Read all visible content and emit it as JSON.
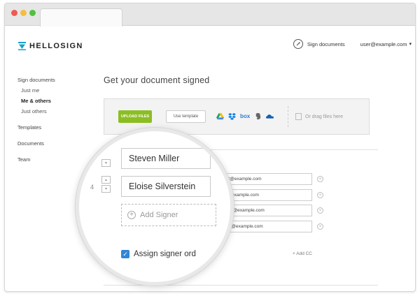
{
  "brand": {
    "name": "HELLOSIGN",
    "color": "#18a0c9"
  },
  "header": {
    "sign_link": "Sign documents",
    "user_email": "user@example.com",
    "icons": {
      "sign": "pen-icon",
      "chevron": "chevron-down-icon"
    }
  },
  "sidebar": {
    "section_title": "Sign documents",
    "sub_items": [
      "Just me",
      "Me & others",
      "Just others"
    ],
    "active_sub": "Me & others",
    "items": [
      "Templates",
      "Documents",
      "Team"
    ]
  },
  "main": {
    "title": "Get your document signed",
    "upload_button": "UPLOAD FILES",
    "template_button": "Use template",
    "providers": [
      "google-drive-icon",
      "dropbox-icon",
      "box-icon",
      "evernote-icon",
      "onedrive-icon"
    ],
    "box_label": "box",
    "drag_text": "Or drag files here",
    "upload_color": "#8bbe23"
  },
  "signers": {
    "emails": [
      "albert@example.com",
      "rosa@example.com",
      "s.miller@example.com",
      "ellie_s@example.com"
    ],
    "add_cc": "+ Add CC"
  },
  "magnifier": {
    "row_number": "4",
    "names": [
      "Steven Miller",
      "Eloise Silverstein"
    ],
    "add_signer": "Add Signer",
    "assign_order": "Assign signer ord",
    "checkbox_color": "#2f86d8"
  }
}
